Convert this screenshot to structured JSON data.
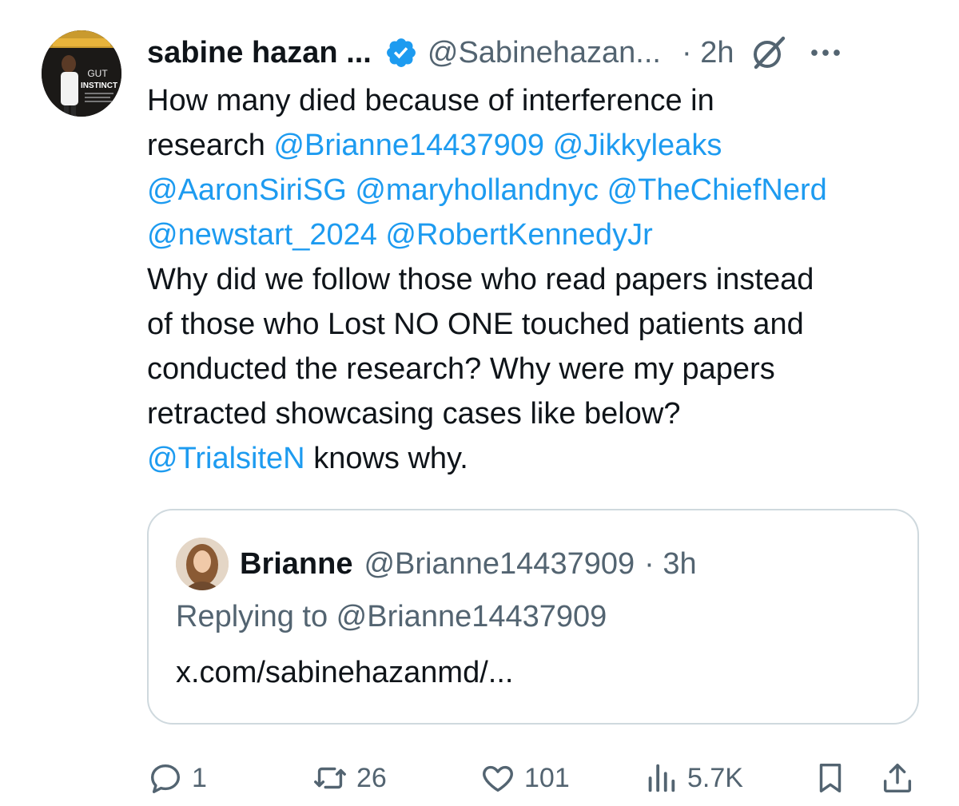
{
  "author": {
    "display_name": "sabine hazan ...",
    "handle": "@Sabinehazan...",
    "time": "· 2h",
    "avatar_caption": "GUT INSTINCT"
  },
  "tweet": {
    "line1": "How many died because of interference in",
    "line2_prefix": "research",
    "mentions": [
      "@Brianne14437909",
      "@Jikkyleaks",
      "@AaronSiriSG",
      "@maryhollandnyc",
      "@TheChiefNerd",
      "@newstart_2024",
      "@RobertKennedyJr"
    ],
    "body_lines": [
      "Why did we follow those who read papers instead",
      "of those who Lost NO ONE touched patients and",
      "conducted the research? Why were my papers",
      "retracted showcasing cases like below?"
    ],
    "final_mention": "@TrialsiteN",
    "final_text": "knows why."
  },
  "quote": {
    "display_name": "Brianne",
    "handle": "@Brianne14437909",
    "time": "· 3h",
    "replying_to": "Replying to @Brianne14437909",
    "link": "x.com/sabinehazanmd/..."
  },
  "actions": {
    "replies": "1",
    "reposts": "26",
    "likes": "101",
    "views": "5.7K"
  },
  "colors": {
    "mention": "#1d9bf0",
    "secondary_text": "#536471",
    "verified": "#1d9bf0",
    "border": "#cfd9de"
  },
  "icons": [
    "verified-badge-icon",
    "grok-icon",
    "more-icon",
    "reply-icon",
    "repost-icon",
    "like-icon",
    "views-icon",
    "bookmark-icon",
    "share-icon"
  ]
}
